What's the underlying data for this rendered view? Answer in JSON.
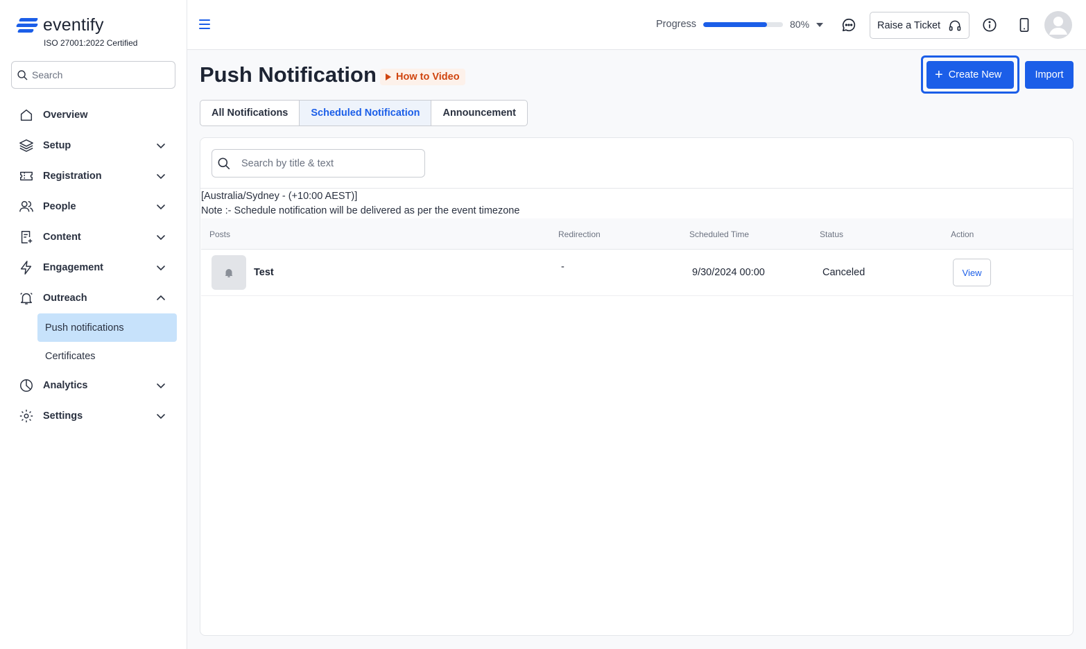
{
  "brand": {
    "name": "eventify",
    "certification": "ISO 27001:2022 Certified",
    "accent": "#1b5ee8"
  },
  "sidebar": {
    "search_placeholder": "Search",
    "items": [
      {
        "label": "Overview",
        "icon": "home-icon"
      },
      {
        "label": "Setup",
        "icon": "layers-icon"
      },
      {
        "label": "Registration",
        "icon": "ticket-icon"
      },
      {
        "label": "People",
        "icon": "people-icon"
      },
      {
        "label": "Content",
        "icon": "content-icon"
      },
      {
        "label": "Engagement",
        "icon": "lightning-icon"
      },
      {
        "label": "Outreach",
        "icon": "bell-alert-icon"
      },
      {
        "label": "Analytics",
        "icon": "pie-chart-icon"
      },
      {
        "label": "Settings",
        "icon": "gear-icon"
      }
    ],
    "outreach_sub": [
      {
        "label": "Push notifications",
        "active": true
      },
      {
        "label": "Certificates",
        "active": false
      }
    ]
  },
  "topbar": {
    "progress_label": "Progress",
    "progress_value": 80,
    "progress_text": "80%",
    "ticket_label": "Raise a Ticket"
  },
  "main": {
    "title": "Push Notification",
    "how_to_label": "How to Video",
    "create_label": "Create New",
    "import_label": "Import",
    "tabs": [
      {
        "label": "All Notifications",
        "active": false
      },
      {
        "label": "Scheduled Notification",
        "active": true
      },
      {
        "label": "Announcement",
        "active": false
      }
    ],
    "search_placeholder": "Search by title & text",
    "timezone": "[Australia/Sydney - (+10:00 AEST)]",
    "note": "Note :- Schedule notification will be delivered as per the event timezone",
    "table": {
      "headers": [
        "Posts",
        "Redirection",
        "Scheduled Time",
        "Status",
        "Action"
      ],
      "rows": [
        {
          "post": "Test",
          "redirection": "-",
          "scheduled_time": "9/30/2024 00:00",
          "status": "Canceled",
          "action": "View"
        }
      ]
    }
  }
}
